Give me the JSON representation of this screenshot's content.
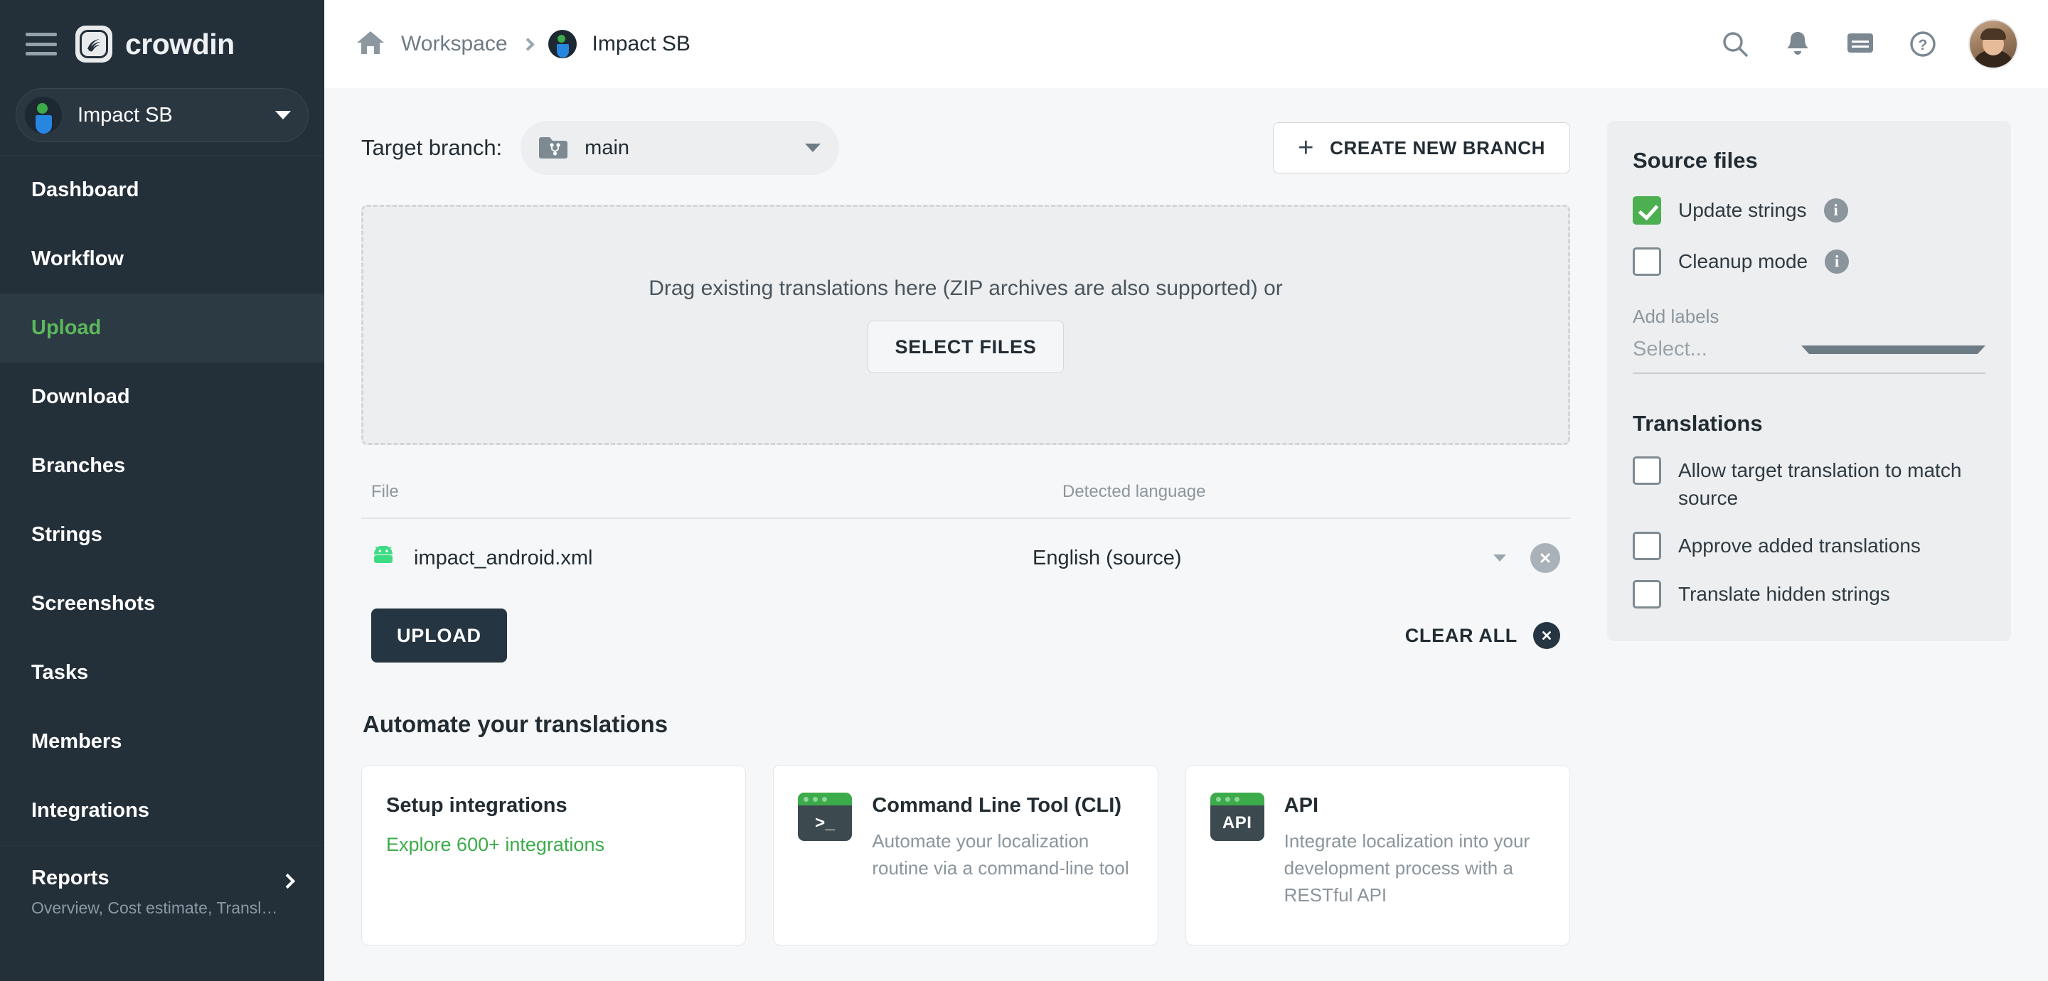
{
  "sidebar": {
    "brand": "crowdin",
    "menu_icon": "hamburger-menu-icon",
    "project": {
      "name": "Impact SB"
    },
    "items": [
      {
        "label": "Dashboard",
        "active": false
      },
      {
        "label": "Workflow",
        "active": false
      },
      {
        "label": "Upload",
        "active": true
      },
      {
        "label": "Download",
        "active": false
      },
      {
        "label": "Branches",
        "active": false
      },
      {
        "label": "Strings",
        "active": false
      },
      {
        "label": "Screenshots",
        "active": false
      },
      {
        "label": "Tasks",
        "active": false
      },
      {
        "label": "Members",
        "active": false
      },
      {
        "label": "Integrations",
        "active": false
      }
    ],
    "reports": {
      "label": "Reports",
      "subtitle": "Overview, Cost estimate, Transl…"
    }
  },
  "topbar": {
    "breadcrumb": {
      "home_icon": "home-icon",
      "workspace": "Workspace",
      "current": "Impact SB"
    },
    "icons": [
      {
        "name": "search-icon"
      },
      {
        "name": "notifications-bell-icon"
      },
      {
        "name": "messages-icon"
      },
      {
        "name": "help-icon"
      }
    ]
  },
  "main": {
    "branch": {
      "label": "Target branch:",
      "value": "main",
      "icon": "branch-folder-icon"
    },
    "create_branch_button": "CREATE NEW BRANCH",
    "dropzone": {
      "text": "Drag existing translations here (ZIP archives are also supported) or",
      "select_files_button": "SELECT FILES"
    },
    "files_table": {
      "columns": {
        "file": "File",
        "language": "Detected language"
      },
      "rows": [
        {
          "file": "impact_android.xml",
          "icon": "android-file-icon",
          "language": "English (source)"
        }
      ]
    },
    "upload_button": "UPLOAD",
    "clear_all_button": "CLEAR ALL",
    "automate": {
      "title": "Automate your translations",
      "cards": [
        {
          "title": "Setup integrations",
          "link": "Explore 600+ integrations",
          "desc": "",
          "icon": ""
        },
        {
          "title": "Command Line Tool (CLI)",
          "desc": "Automate your localization routine via a command-line tool",
          "icon": "terminal-icon",
          "icon_text": ">_",
          "link": ""
        },
        {
          "title": "API",
          "desc": "Integrate localization into your development process with a RESTful API",
          "icon": "api-icon",
          "icon_text": "API",
          "link": ""
        }
      ]
    }
  },
  "panel": {
    "source_files_title": "Source files",
    "update_strings": {
      "label": "Update strings",
      "checked": true
    },
    "cleanup_mode": {
      "label": "Cleanup mode",
      "checked": false
    },
    "add_labels_label": "Add labels",
    "add_labels_placeholder": "Select...",
    "translations_title": "Translations",
    "translations_options": [
      {
        "label": "Allow target translation to match source",
        "checked": false
      },
      {
        "label": "Approve added translations",
        "checked": false
      },
      {
        "label": "Translate hidden strings",
        "checked": false
      }
    ]
  },
  "colors": {
    "accent_green": "#4caf50",
    "link_green": "#3cab4a",
    "sidebar": "#232f39",
    "dark_button": "#253541"
  }
}
